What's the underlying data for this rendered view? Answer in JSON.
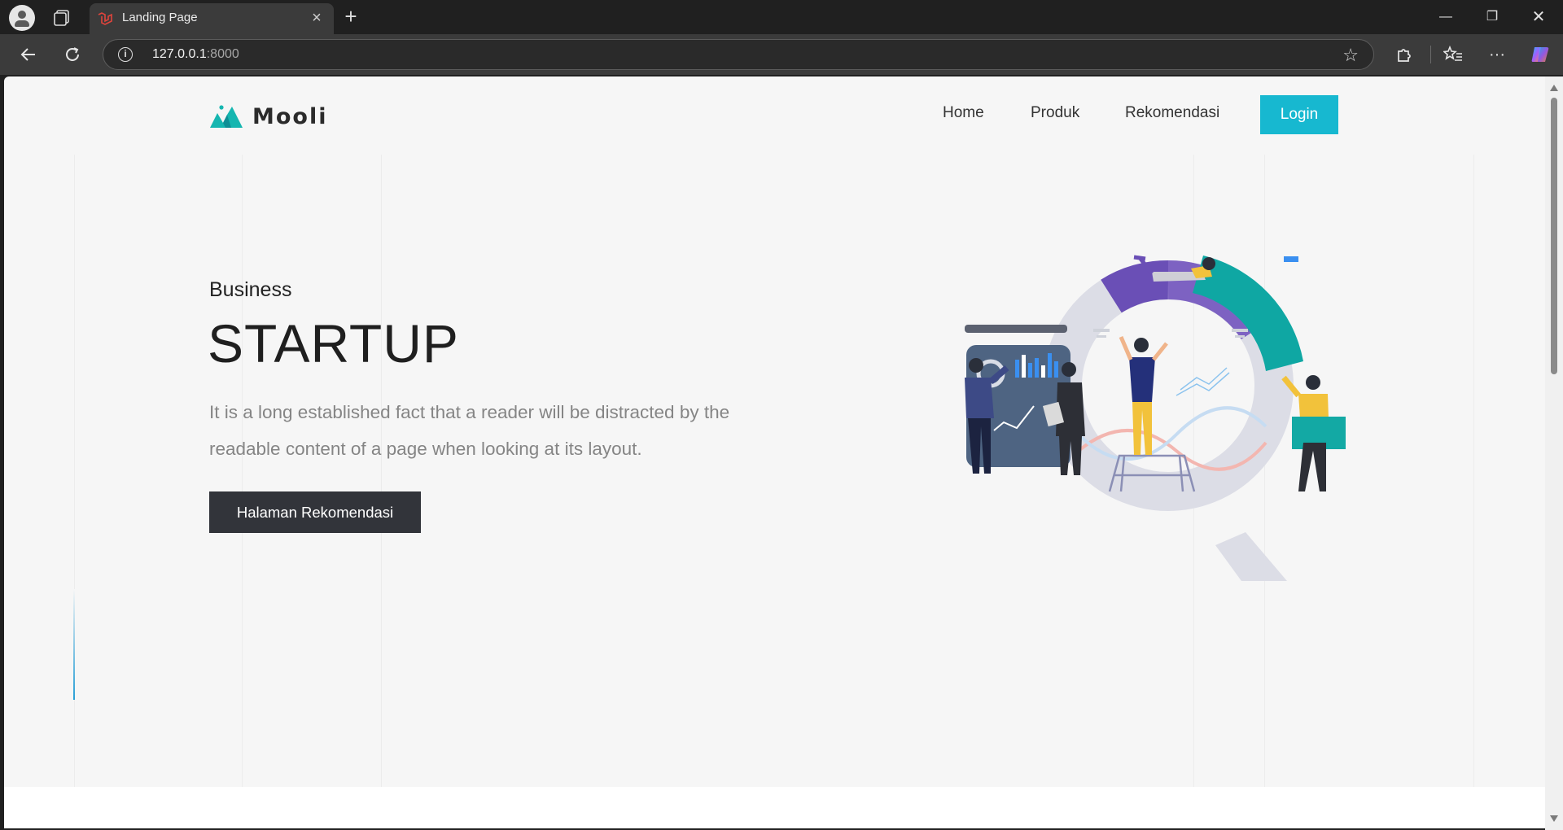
{
  "browser": {
    "tab_title": "Landing Page",
    "url_host": "127.0.0.1",
    "url_port": ":8000"
  },
  "site": {
    "logo_text": "Mooli",
    "nav": [
      "Home",
      "Produk",
      "Rekomendasi"
    ],
    "login_label": "Login"
  },
  "hero": {
    "kicker": "Business",
    "title": "STARTUP",
    "text": "It is a long established fact that a reader will be distracted by the readable content of a page when looking at its layout.",
    "button_label": "Halaman Rekomendasi",
    "illustration_icon": "business-team-chart-illustration"
  },
  "colors": {
    "accent": "#17b8d0",
    "button_dark": "#32343a",
    "teal": "#0fa7a3",
    "purple": "#6a4fb6"
  }
}
